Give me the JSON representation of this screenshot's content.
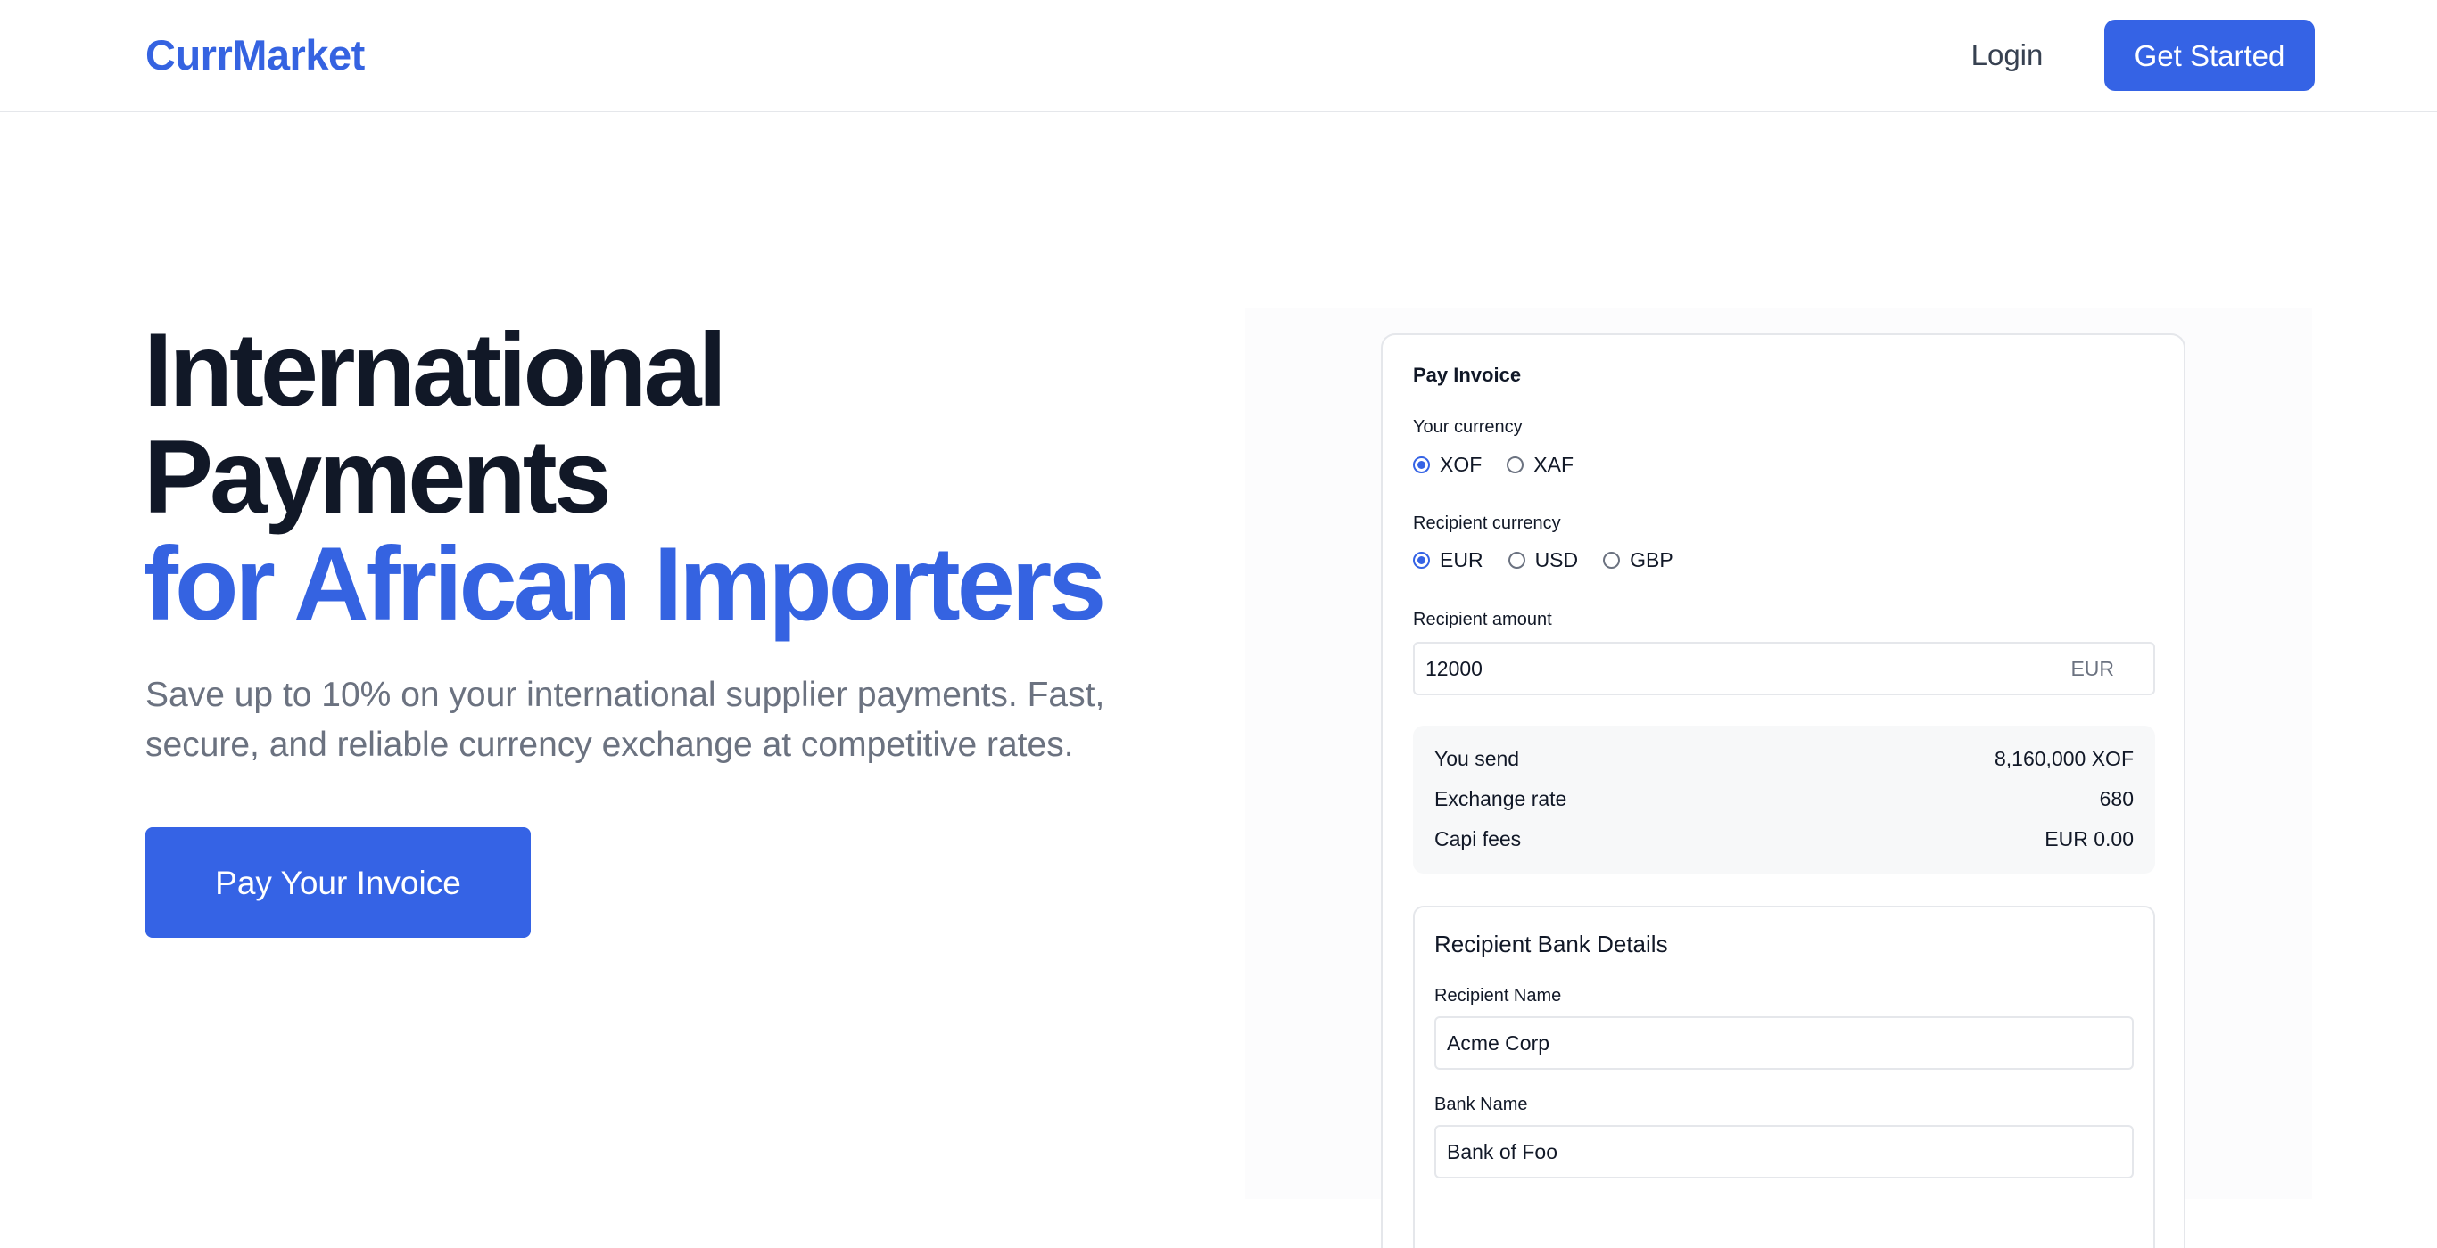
{
  "header": {
    "logo": "CurrMarket",
    "login_label": "Login",
    "get_started_label": "Get Started"
  },
  "hero": {
    "title_line1": "International",
    "title_line2": "Payments",
    "title_line3": "for African Importers",
    "subtitle": "Save up to 10% on your international supplier payments. Fast, secure, and reliable currency exchange at competitive rates.",
    "cta_label": "Pay Your Invoice"
  },
  "form": {
    "title": "Pay Invoice",
    "your_currency": {
      "label": "Your currency",
      "options": [
        "XOF",
        "XAF"
      ],
      "selected": "XOF"
    },
    "recipient_currency": {
      "label": "Recipient currency",
      "options": [
        "EUR",
        "USD",
        "GBP"
      ],
      "selected": "EUR"
    },
    "recipient_amount": {
      "label": "Recipient amount",
      "value": "12000",
      "suffix": "EUR"
    },
    "summary": {
      "you_send_label": "You send",
      "you_send_value": "8,160,000 XOF",
      "exchange_rate_label": "Exchange rate",
      "exchange_rate_value": "680",
      "fees_label": "Capi fees",
      "fees_value": "EUR 0.00"
    },
    "bank": {
      "title": "Recipient Bank Details",
      "recipient_name_label": "Recipient Name",
      "recipient_name_value": "Acme Corp",
      "bank_name_label": "Bank Name",
      "bank_name_value": "Bank of Foo"
    }
  },
  "colors": {
    "accent": "#3563e5",
    "heading": "#111827",
    "muted": "#6b7280",
    "border": "#e5e7eb"
  }
}
